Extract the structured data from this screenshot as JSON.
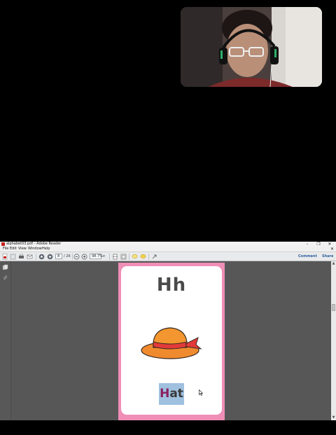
{
  "window": {
    "title": "alphabet03.pdf - Adobe Reader",
    "controls": {
      "minimize": "–",
      "restore": "❐",
      "close": "✕"
    }
  },
  "menu": [
    "File",
    "Edit",
    "View",
    "Window",
    "Help"
  ],
  "toolbar": {
    "page_current": "8",
    "page_total": "/ 26",
    "zoom": "98.7%",
    "comment_label": "Comment",
    "share_label": "Share"
  },
  "card": {
    "letter": "Hh",
    "word_first": "H",
    "word_rest": "at"
  },
  "colors": {
    "page_bg": "#ef8eb6",
    "word_highlight": "#9fc0df",
    "word_first_letter": "#8c1f5e",
    "hat_main": "#f08a2e",
    "hat_band": "#e23a3a"
  },
  "icons": {
    "webcam": "webcam-feed",
    "hat": "hat-illustration"
  }
}
